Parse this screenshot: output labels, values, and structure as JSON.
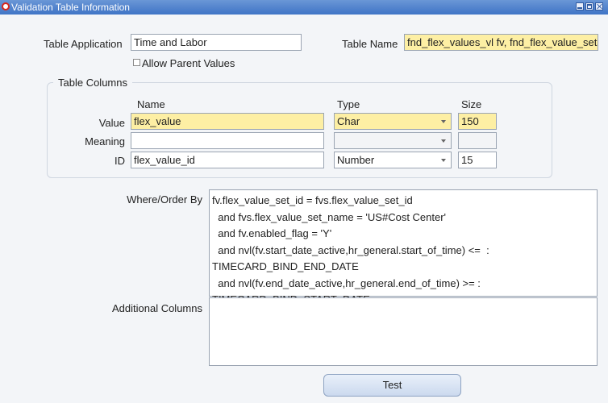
{
  "window": {
    "title": "Validation Table Information"
  },
  "form": {
    "table_application": {
      "label": "Table Application",
      "value": "Time and Labor"
    },
    "table_name": {
      "label": "Table Name",
      "value": "fnd_flex_values_vl fv, fnd_flex_value_sets"
    },
    "allow_parent": {
      "label": "Allow Parent Values",
      "checked": false
    }
  },
  "columns": {
    "group_label": "Table Columns",
    "headers": {
      "name": "Name",
      "type": "Type",
      "size": "Size"
    },
    "rows": [
      {
        "label": "Value",
        "name": "flex_value",
        "type": "Char",
        "size": "150"
      },
      {
        "label": "Meaning",
        "name": "",
        "type": "",
        "size": ""
      },
      {
        "label": "ID",
        "name": "flex_value_id",
        "type": "Number",
        "size": "15"
      }
    ]
  },
  "where": {
    "label": "Where/Order By",
    "lines": [
      "fv.flex_value_set_id = fvs.flex_value_set_id",
      "  and fvs.flex_value_set_name = 'US#Cost Center'",
      "  and fv.enabled_flag = 'Y'",
      "  and nvl(fv.start_date_active,hr_general.start_of_time) <=  :",
      "TIMECARD_BIND_END_DATE",
      "  and nvl(fv.end_date_active,hr_general.end_of_time) >= :",
      "TIMECARD_BIND_START_DATE"
    ]
  },
  "additional": {
    "label": "Additional Columns",
    "value": ""
  },
  "buttons": {
    "test": "Test"
  }
}
